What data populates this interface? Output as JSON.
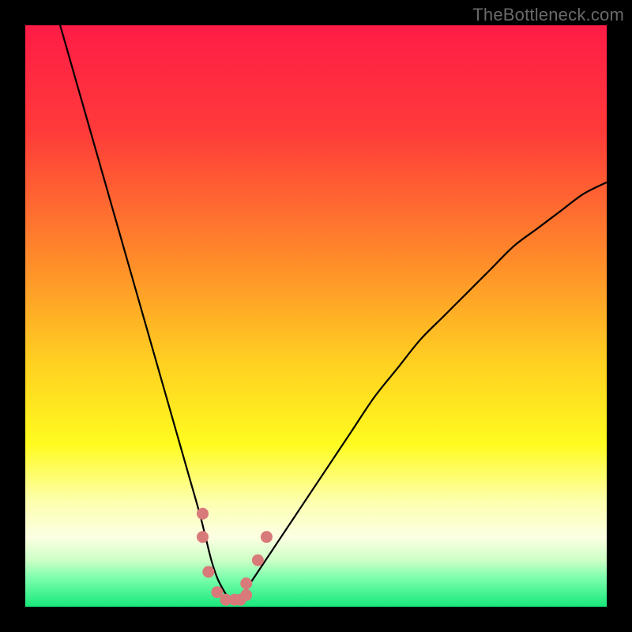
{
  "watermark": "TheBottleneck.com",
  "chart_data": {
    "type": "line",
    "title": "",
    "xlabel": "",
    "ylabel": "",
    "xlim": [
      0,
      100
    ],
    "ylim": [
      0,
      100
    ],
    "curve": {
      "name": "bottleneck-curve",
      "x": [
        6,
        8,
        10,
        12,
        14,
        16,
        18,
        20,
        22,
        24,
        26,
        28,
        30,
        31,
        32,
        33,
        34,
        35,
        36,
        37,
        38,
        40,
        44,
        48,
        52,
        56,
        60,
        64,
        68,
        72,
        76,
        80,
        84,
        88,
        92,
        96,
        100
      ],
      "y": [
        100,
        93,
        86,
        79,
        72,
        65,
        58,
        51,
        44,
        37,
        30,
        23,
        16,
        12,
        8,
        5,
        3,
        1.5,
        1,
        1.5,
        3,
        6,
        12,
        18,
        24,
        30,
        36,
        41,
        46,
        50,
        54,
        58,
        62,
        65,
        68,
        71,
        73
      ]
    },
    "markers": {
      "name": "highlight-points",
      "x": [
        30.5,
        30.5,
        31.5,
        33,
        34.5,
        36,
        37,
        38,
        38,
        40,
        41.5
      ],
      "y": [
        16,
        12,
        6,
        2.5,
        1.2,
        1.2,
        1.2,
        2,
        4,
        8,
        12
      ],
      "color": "#d97a7a",
      "size": 7.5
    },
    "background_gradient": {
      "stops": [
        {
          "offset": 0.0,
          "color": "#ff1c46"
        },
        {
          "offset": 0.18,
          "color": "#ff3a3a"
        },
        {
          "offset": 0.4,
          "color": "#ff8a2a"
        },
        {
          "offset": 0.58,
          "color": "#ffd021"
        },
        {
          "offset": 0.72,
          "color": "#fffb1f"
        },
        {
          "offset": 0.82,
          "color": "#fdffaf"
        },
        {
          "offset": 0.88,
          "color": "#fcffe2"
        },
        {
          "offset": 0.92,
          "color": "#cdffc6"
        },
        {
          "offset": 0.95,
          "color": "#7dffad"
        },
        {
          "offset": 1.0,
          "color": "#17e87a"
        }
      ]
    }
  }
}
